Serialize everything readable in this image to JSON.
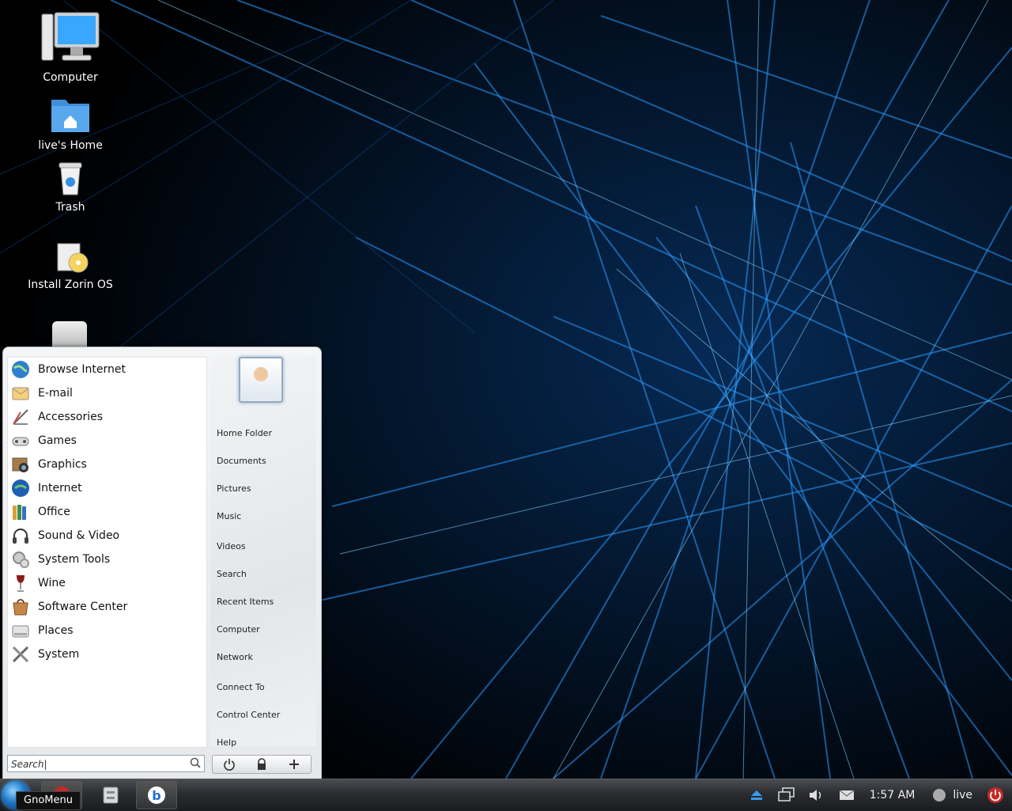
{
  "desktop": {
    "icons": [
      {
        "label": "Computer"
      },
      {
        "label": "live's Home"
      },
      {
        "label": "Trash"
      },
      {
        "label": "Install Zorin OS"
      }
    ]
  },
  "menu": {
    "categories": [
      {
        "label": "Browse Internet",
        "icon": "globe-icon"
      },
      {
        "label": "E-mail",
        "icon": "email-icon"
      },
      {
        "label": "Accessories",
        "icon": "accessories-icon"
      },
      {
        "label": "Games",
        "icon": "gamepad-icon"
      },
      {
        "label": "Graphics",
        "icon": "graphics-icon"
      },
      {
        "label": "Internet",
        "icon": "internet-icon"
      },
      {
        "label": "Office",
        "icon": "office-icon"
      },
      {
        "label": "Sound & Video",
        "icon": "headphones-icon"
      },
      {
        "label": "System Tools",
        "icon": "system-tools-icon"
      },
      {
        "label": "Wine",
        "icon": "wine-icon"
      },
      {
        "label": "Software Center",
        "icon": "software-center-icon"
      },
      {
        "label": "Places",
        "icon": "places-icon"
      },
      {
        "label": "System",
        "icon": "system-icon"
      }
    ],
    "places": [
      "Home Folder",
      "Documents",
      "Pictures",
      "Music",
      "Videos",
      "Search",
      "Recent Items",
      "Computer",
      "Network",
      "Connect To",
      "Control Center",
      "Help"
    ],
    "search": {
      "value": "Search|"
    }
  },
  "taskbar": {
    "tooltip": "GnoMenu",
    "clock": "1:57 AM",
    "user": "live"
  },
  "colors": {
    "accent": "#1f8fff",
    "taskbar": "#2a2c30"
  }
}
